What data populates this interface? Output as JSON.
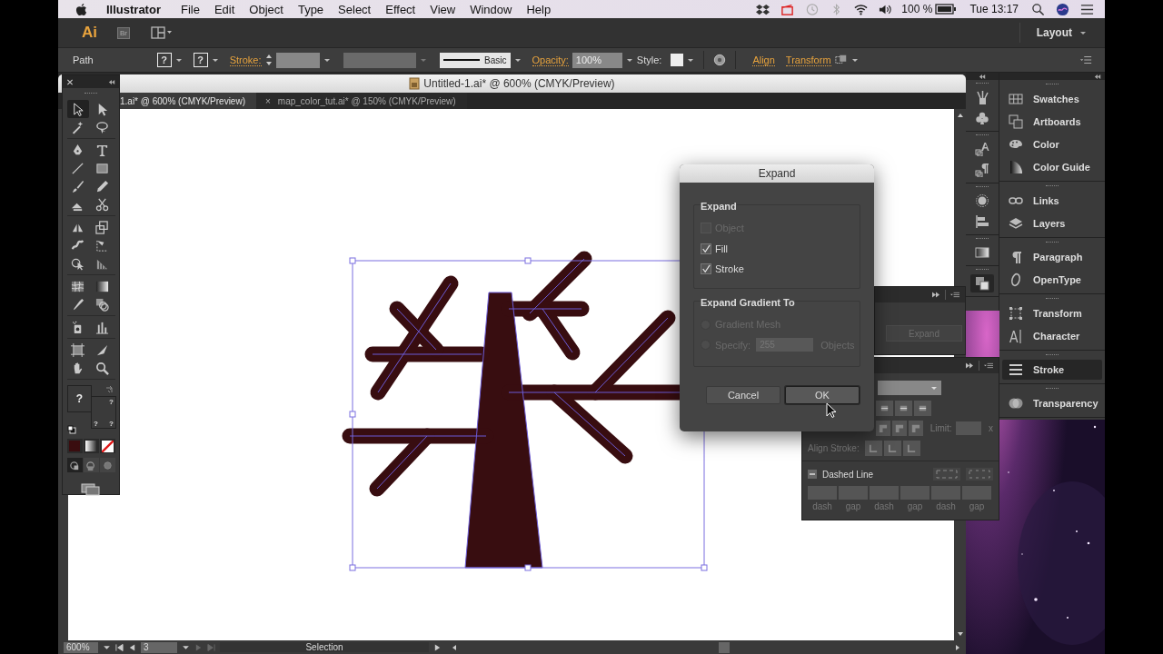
{
  "menu_bar": {
    "app": "Illustrator",
    "menus": [
      "File",
      "Edit",
      "Object",
      "Type",
      "Select",
      "Effect",
      "View",
      "Window",
      "Help"
    ],
    "battery": "100 %",
    "clock": "Tue 13:17"
  },
  "app_bar": {
    "logo": "Ai",
    "bridge": "Br",
    "workspace": "Layout"
  },
  "control_bar": {
    "selection_type": "Path",
    "fill_mark": "?",
    "stroke_mark": "?",
    "stroke_label": "Stroke:",
    "brush": "Basic",
    "opacity_label": "Opacity:",
    "opacity": "100%",
    "style_label": "Style:",
    "links": [
      "Align",
      "Transform"
    ]
  },
  "document": {
    "title": "Untitled-1.ai* @ 600% (CMYK/Preview)",
    "close_glyph": "×",
    "tabs": [
      {
        "label": "1.ai* @ 600% (CMYK/Preview)",
        "selected": true
      },
      {
        "label": "map_color_tut.ai* @ 150% (CMYK/Preview)",
        "selected": false
      }
    ],
    "status_bar": {
      "zoom": "600%",
      "artboard": "3",
      "tool": "Selection"
    }
  },
  "tools": {
    "groups": [
      [
        {
          "kind": "selection",
          "selected": true
        },
        {
          "kind": "direct-selection",
          "selected": false
        },
        {
          "kind": "magic-wand",
          "selected": false
        },
        {
          "kind": "lasso",
          "selected": false
        }
      ],
      [
        {
          "kind": "pen",
          "selected": false
        },
        {
          "kind": "type",
          "selected": false
        },
        {
          "kind": "line",
          "selected": false
        },
        {
          "kind": "rectangle",
          "selected": false
        },
        {
          "kind": "paintbrush",
          "selected": false
        },
        {
          "kind": "pencil",
          "selected": false
        },
        {
          "kind": "shaper",
          "selected": false
        },
        {
          "kind": "scissors",
          "selected": false
        }
      ],
      [
        {
          "kind": "reflect",
          "selected": false
        },
        {
          "kind": "scale",
          "selected": false
        },
        {
          "kind": "warp",
          "selected": false
        },
        {
          "kind": "free-transform",
          "selected": false
        },
        {
          "kind": "shape-builder",
          "selected": false
        },
        {
          "kind": "perspective",
          "selected": false
        }
      ],
      [
        {
          "kind": "mesh",
          "selected": false
        },
        {
          "kind": "gradient",
          "selected": false
        },
        {
          "kind": "eyedropper",
          "selected": false
        },
        {
          "kind": "blend",
          "selected": false
        }
      ],
      [
        {
          "kind": "symbol-sprayer",
          "selected": false
        },
        {
          "kind": "column-graph",
          "selected": false
        }
      ],
      [
        {
          "kind": "artboard",
          "selected": false
        },
        {
          "kind": "slice",
          "selected": false
        },
        {
          "kind": "hand",
          "selected": false
        },
        {
          "kind": "zoom",
          "selected": false
        }
      ]
    ],
    "fill_mark": "?",
    "stroke_marks": [
      "?",
      "?",
      "?"
    ],
    "color_modes": [
      {
        "kind": "color",
        "color": "#3a0d0f"
      },
      {
        "kind": "gradient"
      },
      {
        "kind": "none"
      }
    ],
    "draw_modes": [
      {
        "kind": "normal",
        "selected": true
      },
      {
        "kind": "behind",
        "selected": false
      },
      {
        "kind": "inside",
        "selected": false
      }
    ]
  },
  "dialog": {
    "title": "Expand",
    "expand_group": {
      "label": "Expand",
      "options": [
        {
          "label": "Object",
          "checked": false,
          "disabled": true
        },
        {
          "label": "Fill",
          "checked": true,
          "disabled": false
        },
        {
          "label": "Stroke",
          "checked": true,
          "disabled": false
        }
      ]
    },
    "gradient_group": {
      "label": "Expand Gradient To",
      "options": [
        {
          "label": "Gradient Mesh",
          "selected": false,
          "disabled": true
        },
        {
          "label": "Specify:",
          "selected": false,
          "disabled": true
        }
      ],
      "specify_value": "255",
      "specify_unit": "Objects"
    },
    "buttons": [
      {
        "label": "Cancel",
        "default": false
      },
      {
        "label": "OK",
        "default": true
      }
    ]
  },
  "floating_panels": {
    "upper": {
      "button": "Expand"
    },
    "stroke": {
      "limit_label": "Limit:",
      "limit_unit": "x",
      "align_label": "Align Stroke:",
      "dashed_label": "Dashed Line",
      "dash_fields": [
        "dash",
        "gap",
        "dash",
        "gap",
        "dash",
        "gap"
      ]
    }
  },
  "icon_dock": {
    "groups": [
      [
        {
          "kind": "brushes",
          "selected": false
        },
        {
          "kind": "symbols",
          "selected": false
        }
      ],
      [
        {
          "kind": "character-styles",
          "selected": false
        },
        {
          "kind": "paragraph-styles",
          "selected": false
        }
      ],
      [
        {
          "kind": "appearance",
          "selected": false
        },
        {
          "kind": "align",
          "selected": false
        }
      ],
      [
        {
          "kind": "gradient",
          "selected": false
        }
      ],
      [
        {
          "kind": "pathfinder",
          "selected": true
        }
      ]
    ]
  },
  "panel_dock": {
    "groups": [
      [
        {
          "label": "Swatches",
          "kind": "swatches",
          "selected": false
        },
        {
          "label": "Artboards",
          "kind": "artboards",
          "selected": false
        },
        {
          "label": "Color",
          "kind": "color",
          "selected": false
        },
        {
          "label": "Color Guide",
          "kind": "color-guide",
          "selected": false
        }
      ],
      [
        {
          "label": "Links",
          "kind": "links",
          "selected": false
        },
        {
          "label": "Layers",
          "kind": "layers",
          "selected": false
        }
      ],
      [
        {
          "label": "Paragraph",
          "kind": "paragraph",
          "selected": false
        },
        {
          "label": "OpenType",
          "kind": "opentype",
          "selected": false
        }
      ],
      [
        {
          "label": "Transform",
          "kind": "transform",
          "selected": false
        },
        {
          "label": "Character",
          "kind": "character",
          "selected": false
        }
      ],
      [
        {
          "label": "Stroke",
          "kind": "stroke",
          "selected": true
        }
      ],
      [
        {
          "label": "Transparency",
          "kind": "transparency",
          "selected": false
        }
      ]
    ]
  }
}
